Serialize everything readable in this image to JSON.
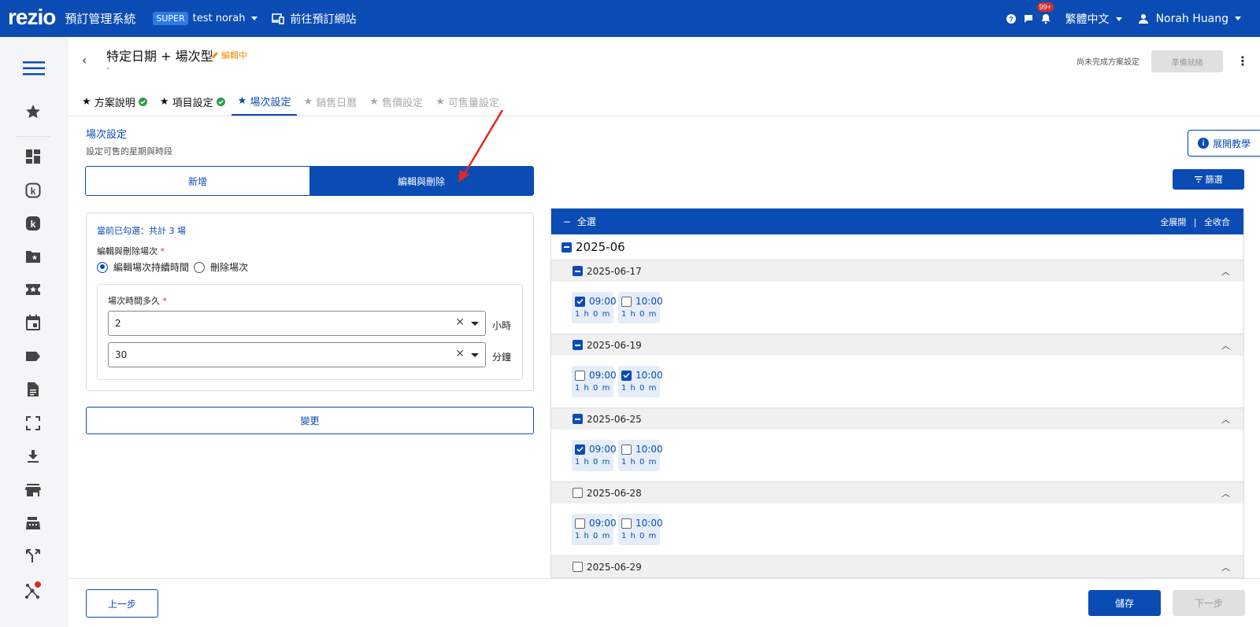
{
  "topbar": {
    "logo": "rezio",
    "system_title": "預訂管理系統",
    "badge": "SUPER",
    "account": "test norah",
    "goto_site": "前往預訂網站",
    "notification_count": "99+",
    "language": "繁體中文",
    "user_name": "Norah Huang"
  },
  "sidebar": {
    "items": [
      "menu-icon",
      "star-icon",
      "dashboard-icon",
      "k-outline-icon",
      "k-filled-icon",
      "folder-star-icon",
      "ticket-star-icon",
      "calendar-icon",
      "tag-icon",
      "document-icon",
      "fullscreen-icon",
      "download-icon",
      "store-icon",
      "register-icon",
      "merge-icon",
      "network-icon"
    ]
  },
  "header": {
    "back": "‹",
    "title": "特定日期 + 場次型",
    "editing": "編輯中",
    "subtitle": "-",
    "unfinished": "尚未完成方案設定",
    "ready_button": "準備就緒"
  },
  "tabs": [
    {
      "label": "方案說明",
      "state": "done"
    },
    {
      "label": "項目設定",
      "state": "done"
    },
    {
      "label": "場次設定",
      "state": "active"
    },
    {
      "label": "銷售日曆",
      "state": "disabled"
    },
    {
      "label": "售價設定",
      "state": "disabled"
    },
    {
      "label": "可售量設定",
      "state": "disabled"
    }
  ],
  "section": {
    "title": "場次設定",
    "desc": "設定可售的星期與時段",
    "tutorial": "展開教學",
    "filter": "篩選"
  },
  "segment": {
    "add": "新增",
    "edit_delete": "編輯與刪除"
  },
  "left_panel": {
    "selected_count": "當前已勾選：共計 3 場",
    "action_label": "編輯與刪除場次",
    "option_edit": "編輯場次持續時間",
    "option_delete": "刪除場次",
    "duration_label": "場次時間多久",
    "hours_value": "2",
    "hours_unit": "小時",
    "minutes_value": "30",
    "minutes_unit": "分鐘",
    "change_button": "變更"
  },
  "right_panel": {
    "select_all": "全選",
    "expand_all": "全展開",
    "separator": "|",
    "collapse_all": "全收合",
    "month": "2025-06",
    "dates": [
      {
        "date": "2025-06-17",
        "state": "partial",
        "slots": [
          {
            "time": "09:00",
            "dur": "1 h 0 m",
            "checked": true
          },
          {
            "time": "10:00",
            "dur": "1 h 0 m",
            "checked": false
          }
        ]
      },
      {
        "date": "2025-06-19",
        "state": "partial",
        "slots": [
          {
            "time": "09:00",
            "dur": "1 h 0 m",
            "checked": false
          },
          {
            "time": "10:00",
            "dur": "1 h 0 m",
            "checked": true
          }
        ]
      },
      {
        "date": "2025-06-25",
        "state": "partial",
        "slots": [
          {
            "time": "09:00",
            "dur": "1 h 0 m",
            "checked": true
          },
          {
            "time": "10:00",
            "dur": "1 h 0 m",
            "checked": false
          }
        ]
      },
      {
        "date": "2025-06-28",
        "state": "none",
        "slots": [
          {
            "time": "09:00",
            "dur": "1 h 0 m",
            "checked": false
          },
          {
            "time": "10:00",
            "dur": "1 h 0 m",
            "checked": false
          }
        ]
      },
      {
        "date": "2025-06-29",
        "state": "none",
        "slots": []
      }
    ]
  },
  "footer": {
    "prev": "上一步",
    "save": "儲存",
    "next": "下一步"
  },
  "colors": {
    "primary": "#0b4cb4",
    "editing": "#f08c00",
    "success": "#2e9e4f",
    "annotation_arrow": "#e8251f"
  }
}
